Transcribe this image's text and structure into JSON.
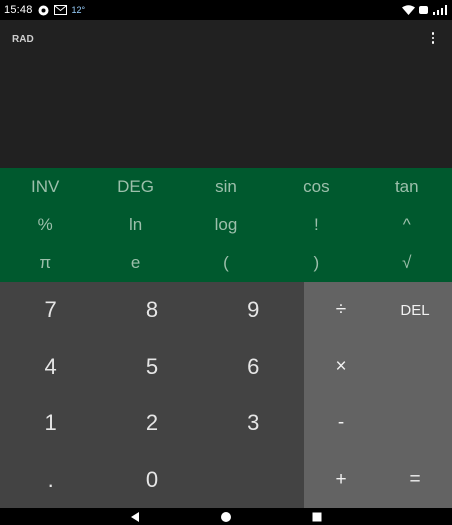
{
  "status_bar": {
    "time": "15:48",
    "temperature": "12°",
    "icons": [
      "assistant-icon",
      "message-icon",
      "wifi-icon",
      "battery-saver-icon",
      "signal-icon"
    ]
  },
  "display": {
    "angle_mode": "RAD",
    "menu_icon": "more-vert-icon"
  },
  "advanced_pad": {
    "rows": [
      [
        "INV",
        "DEG",
        "sin",
        "cos",
        "tan"
      ],
      [
        "%",
        "ln",
        "log",
        "!",
        "^"
      ],
      [
        "π",
        "e",
        "(",
        ")",
        "√"
      ]
    ]
  },
  "numeric_pad": {
    "rows": [
      [
        "7",
        "8",
        "9"
      ],
      [
        "4",
        "5",
        "6"
      ],
      [
        "1",
        "2",
        "3"
      ],
      [
        ".",
        "0",
        ""
      ]
    ]
  },
  "operator_pad": {
    "rows": [
      [
        "÷",
        "DEL"
      ],
      [
        "×",
        ""
      ],
      [
        "-",
        ""
      ],
      [
        "+",
        "="
      ]
    ]
  },
  "nav_bar": {
    "icons": [
      "back-icon",
      "home-icon",
      "recents-icon"
    ]
  },
  "colors": {
    "display_bg": "#212121",
    "advanced_bg": "#00592e",
    "numeric_bg": "#434343",
    "operator_bg": "#636363"
  }
}
